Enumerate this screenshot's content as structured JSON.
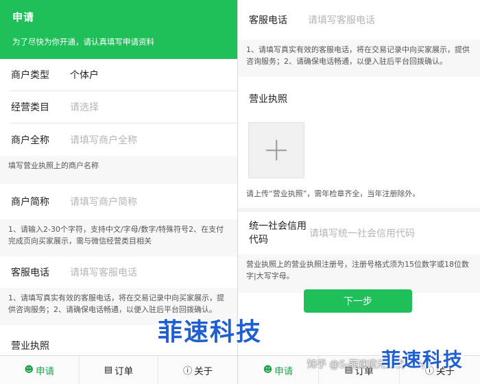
{
  "left": {
    "header": {
      "title": "申请",
      "subtitle": "为了尽快为你开通，请认真填写申请资料"
    },
    "rows": {
      "merchant_type": {
        "label": "商户类型",
        "value": "个体户"
      },
      "business_category": {
        "label": "经营类目",
        "placeholder": "请选择"
      },
      "merchant_full_name": {
        "label": "商户全称",
        "placeholder": "请填写商户全称"
      },
      "merchant_short_name": {
        "label": "商户简称",
        "placeholder": "请填写商户简称"
      },
      "service_phone": {
        "label": "客服电话",
        "placeholder": "请填写客服电话"
      },
      "license": {
        "label": "营业执照"
      }
    },
    "hints": {
      "full_name": "填写营业执照上的商户名称",
      "short_name": "1、请输入2-30个字符，支持中文/字母/数字/特殊符号2、在支付完成页向买家展示，需与微信经营类目相关",
      "service_phone": "1、请填写真实有效的客服电话，将在交易记录中向买家展示，提供咨询服务；2、请确保电话畅通，以便入驻后平台回拨确认。"
    }
  },
  "right": {
    "service_phone": {
      "label": "客服电话",
      "placeholder": "请填写客服电话"
    },
    "service_phone_hint": "1、请填写真实有效的客服电话，将在交易记录中向买家展示，提供咨询服务；2、请确保电话畅通，以便入驻后平台回拨确认。",
    "license": {
      "label": "营业执照",
      "hint": "请上传“营业执照”，需年检章齐全，当年注册除外。"
    },
    "credit_code": {
      "label": "统一社会信用代码",
      "placeholder": "请填写统一社会信用代码",
      "hint": "营业执照上的营业执照注册号，注册号格式须为15位数字或18位数字|大写字母。"
    },
    "next_button": "下一步"
  },
  "tabs": [
    {
      "label": "申请",
      "icon": "person-icon"
    },
    {
      "label": "订单",
      "icon": "clipboard-icon"
    },
    {
      "label": "关于",
      "icon": "info-icon"
    }
  ],
  "watermarks": {
    "brand": "菲速科技",
    "zhihu": "知乎 @S-菲速应用服务平台"
  },
  "colors": {
    "accent": "#1fc05a",
    "watermark": "#1f5fd0"
  }
}
